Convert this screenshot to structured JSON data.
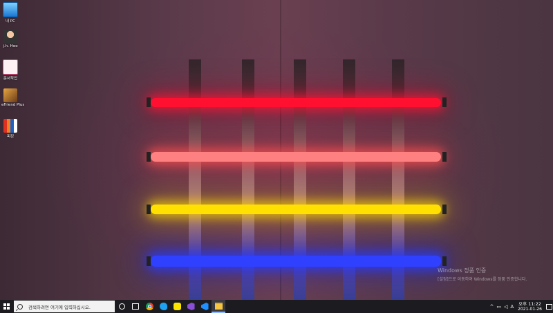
{
  "desktop": {
    "icons": [
      {
        "label": "내 PC",
        "icon": "computer-icon"
      },
      {
        "label": "j.h. Heo",
        "icon": "user-icon"
      },
      {
        "label": "문서작업",
        "icon": "document-icon"
      },
      {
        "label": "eFriend Plus",
        "icon": "efriend-icon"
      },
      {
        "label": "피킹",
        "icon": "bars-icon"
      }
    ],
    "wallpaper_colors": {
      "red": "#ff1030",
      "pink": "#ff8080",
      "yellow": "#ffe000",
      "blue": "#3040ff"
    }
  },
  "watermark": {
    "title": "Windows 정품 인증",
    "subtitle": "[설정]으로 이동하여 Windows를 정품 인증합니다."
  },
  "taskbar": {
    "search_placeholder": "검색하려면 여기에 입력하십시오.",
    "pinned": [
      {
        "name": "cortana",
        "icon": "cortana-icon"
      },
      {
        "name": "task-view",
        "icon": "task-view-icon"
      },
      {
        "name": "chrome",
        "icon": "chrome-icon"
      },
      {
        "name": "bird",
        "icon": "bird-icon"
      },
      {
        "name": "kakaotalk",
        "icon": "kakaotalk-icon"
      },
      {
        "name": "visual-studio",
        "icon": "visual-studio-icon"
      },
      {
        "name": "vscode",
        "icon": "vscode-icon"
      },
      {
        "name": "file-explorer",
        "icon": "folder-icon",
        "active": true
      }
    ],
    "tray": {
      "chevron": "^",
      "ime": "A",
      "time": "오후 11:22",
      "date": "2021-01-26"
    }
  }
}
